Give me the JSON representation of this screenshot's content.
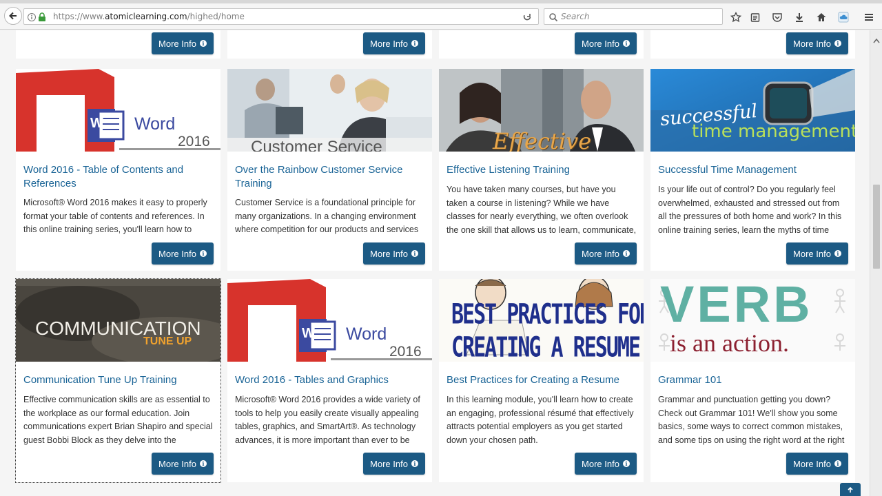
{
  "browser": {
    "url_scheme": "https://www.",
    "url_host": "atomiclearning.com",
    "url_path": "/highed/home",
    "search_placeholder": "Search"
  },
  "more_info_label": "More Info",
  "cards": [
    {
      "title": "Word 2016 - Table of Contents and References",
      "description": "Microsoft® Word 2016 makes it easy to properly format your table of contents and references. In this online training series, you'll learn how to",
      "image": {
        "word_text": "Word",
        "year": "2016"
      }
    },
    {
      "title": "Over the Rainbow Customer Service Training",
      "description": "Customer Service is a foundational principle for many organizations. In a changing environment where competition for our products and services",
      "image": {
        "caption": "Customer Service"
      }
    },
    {
      "title": "Effective Listening Training",
      "description": "You have taken many courses, but have you taken a course in listening? While we have classes for nearly everything, we often overlook the one skill that allows us to learn, communicate, and",
      "image": {
        "caption": "Effective"
      }
    },
    {
      "title": "Successful Time Management",
      "description": "Is your life out of control? Do you regularly feel overwhelmed, exhausted and stressed out from all the pressures of both home and work? In this online training series, learn the myths of time",
      "image": {
        "line1": "successful",
        "line2": "time management"
      }
    },
    {
      "title": "Communication Tune Up Training",
      "description": "Effective communication skills are as essential to the workplace as our formal education. Join communications expert Brian Shapiro and special guest Bobbi Block as they delve into the",
      "image": {
        "line1": "COMMUNICATION",
        "line2": "TUNE UP"
      }
    },
    {
      "title": "Word 2016 - Tables and Graphics",
      "description": "Microsoft® Word 2016 provides a wide variety of tools to help you easily create visually appealing tables, graphics, and SmartArt®. As technology advances, it is more important than ever to be",
      "image": {
        "word_text": "Word",
        "year": "2016"
      }
    },
    {
      "title": "Best Practices for Creating a Resume",
      "description": "In this learning module, you'll learn how to create an engaging, professional résumé that effectively attracts potential employers as you get started down your chosen path.",
      "image": {
        "line1": "BEST PRACTICES FOR",
        "line2": "CREATING A RESUME"
      }
    },
    {
      "title": "Grammar 101",
      "description": "Grammar and punctuation getting you down? Check out Grammar 101! We'll show you some basics, some ways to correct common mistakes, and some tips on using the right word at the right",
      "image": {
        "line1": "VERB",
        "line2": "is an action."
      }
    }
  ]
}
